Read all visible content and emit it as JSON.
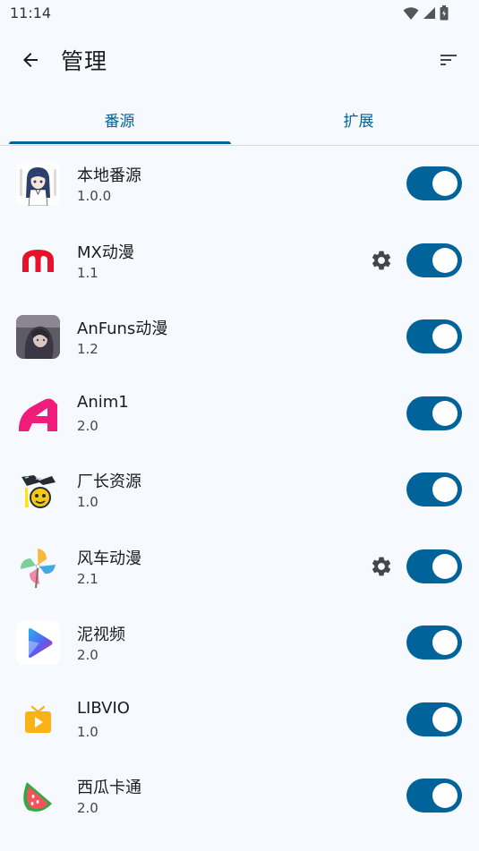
{
  "status_bar": {
    "time": "11:14",
    "icons": [
      "wifi-icon",
      "signal-icon",
      "battery-icon"
    ]
  },
  "app_bar": {
    "back_icon": "arrow-back-icon",
    "title": "管理",
    "sort_icon": "sort-icon"
  },
  "tabs": [
    {
      "label": "番源",
      "selected": true
    },
    {
      "label": "扩展",
      "selected": false
    }
  ],
  "sources": [
    {
      "name": "本地番源",
      "version": "1.0.0",
      "has_settings": false,
      "enabled": true
    },
    {
      "name": "MX动漫",
      "version": "1.1",
      "has_settings": true,
      "enabled": true
    },
    {
      "name": "AnFuns动漫",
      "version": "1.2",
      "has_settings": false,
      "enabled": true
    },
    {
      "name": "Anim1",
      "version": "2.0",
      "has_settings": false,
      "enabled": true
    },
    {
      "name": "厂长资源",
      "version": "1.0",
      "has_settings": false,
      "enabled": true
    },
    {
      "name": "风车动漫",
      "version": "2.1",
      "has_settings": true,
      "enabled": true
    },
    {
      "name": "泥视频",
      "version": "2.0",
      "has_settings": false,
      "enabled": true
    },
    {
      "name": "LIBVIO",
      "version": "1.0",
      "has_settings": false,
      "enabled": true
    },
    {
      "name": "西瓜卡通",
      "version": "2.0",
      "has_settings": false,
      "enabled": true
    }
  ],
  "colors": {
    "primary": "#00639a",
    "background": "#f6fafe",
    "switch_knob": "#ffffff"
  }
}
